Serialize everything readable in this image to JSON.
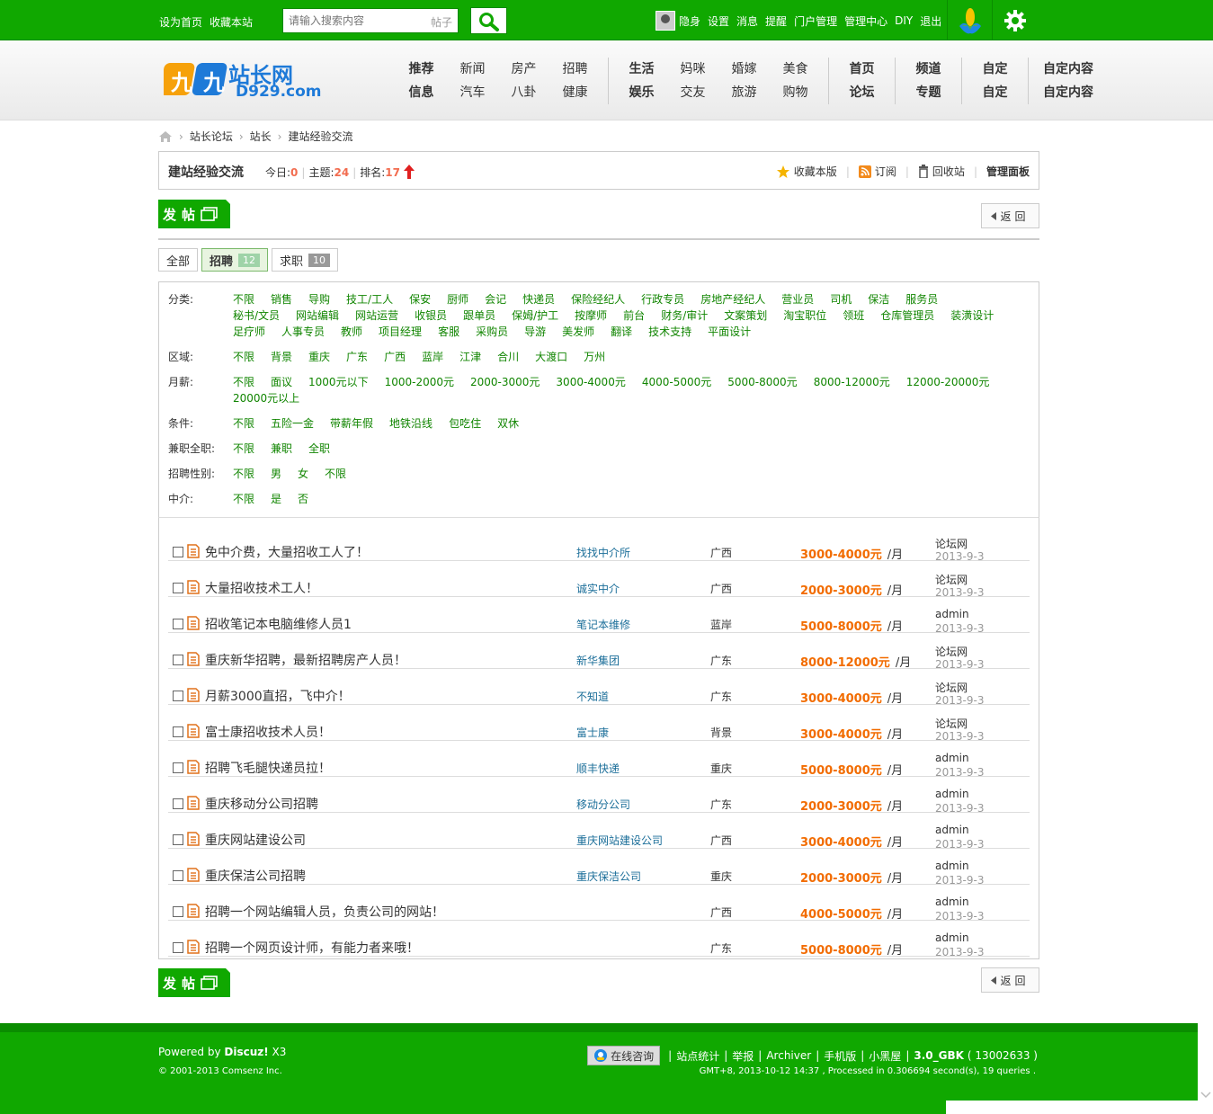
{
  "topbar": {
    "set_home": "设为首页",
    "bookmark": "收藏本站",
    "search_placeholder": "请输入搜索内容",
    "search_scope": "帖子",
    "user_links": [
      "隐身",
      "设置",
      "消息",
      "提醒",
      "门户管理",
      "管理中心",
      "DIY",
      "退出"
    ]
  },
  "logo": {
    "text_cn": "站长网",
    "text_en": "D929.com"
  },
  "nav": {
    "groups": [
      {
        "cols": [
          [
            "推荐",
            "信息"
          ],
          [
            "新闻",
            "汽车"
          ],
          [
            "房产",
            "八卦"
          ],
          [
            "招聘",
            "健康"
          ]
        ],
        "bold_first": true
      },
      {
        "cols": [
          [
            "生活",
            "娱乐"
          ],
          [
            "妈咪",
            "交友"
          ],
          [
            "婚嫁",
            "旅游"
          ],
          [
            "美食",
            "购物"
          ]
        ],
        "bold_first": true
      },
      {
        "cols": [
          [
            "首页",
            "论坛"
          ]
        ],
        "bold_first": true
      },
      {
        "cols": [
          [
            "频道",
            "专题"
          ]
        ],
        "bold_first": true
      },
      {
        "cols": [
          [
            "自定",
            "自定"
          ]
        ],
        "bold_first": true
      },
      {
        "cols": [
          [
            "自定内容",
            "自定内容"
          ]
        ],
        "bold_first": true
      }
    ]
  },
  "breadcrumb": [
    "站长论坛",
    "站长",
    "建站经验交流"
  ],
  "forum": {
    "name": "建站经验交流",
    "today_label": "今日:",
    "today": "0",
    "threads_label": "主题:",
    "threads": "24",
    "rank_label": "排名:",
    "rank": "17",
    "actions": [
      "收藏本版",
      "订阅",
      "回收站",
      "管理面板"
    ]
  },
  "post_button": "发帖",
  "back_button": "返回",
  "tabs": [
    {
      "label": "全部",
      "count": ""
    },
    {
      "label": "招聘",
      "count": "12"
    },
    {
      "label": "求职",
      "count": "10"
    }
  ],
  "filters": [
    {
      "label": "分类:",
      "options": [
        "不限",
        "销售",
        "导购",
        "技工/工人",
        "保安",
        "厨师",
        "会记",
        "快递员",
        "保险经纪人",
        "行政专员",
        "房地产经纪人",
        "营业员",
        "司机",
        "保洁",
        "服务员",
        "秘书/文员",
        "网站编辑",
        "网站运营",
        "收银员",
        "跟单员",
        "保姆/护工",
        "按摩师",
        "前台",
        "财务/审计",
        "文案策划",
        "淘宝职位",
        "领班",
        "仓库管理员",
        "装潢设计",
        "足疗师",
        "人事专员",
        "教师",
        "项目经理",
        "客服",
        "采购员",
        "导游",
        "美发师",
        "翻译",
        "技术支持",
        "平面设计"
      ]
    },
    {
      "label": "区域:",
      "options": [
        "不限",
        "背景",
        "重庆",
        "广东",
        "广西",
        "蓝岸",
        "江津",
        "合川",
        "大渡口",
        "万州"
      ]
    },
    {
      "label": "月薪:",
      "options": [
        "不限",
        "面议",
        "1000元以下",
        "1000-2000元",
        "2000-3000元",
        "3000-4000元",
        "4000-5000元",
        "5000-8000元",
        "8000-12000元",
        "12000-20000元",
        "20000元以上"
      ]
    },
    {
      "label": "条件:",
      "options": [
        "不限",
        "五险一金",
        "带薪年假",
        "地铁沿线",
        "包吃住",
        "双休"
      ]
    },
    {
      "label": "兼职全职:",
      "options": [
        "不限",
        "兼职",
        "全职"
      ]
    },
    {
      "label": "招聘性别:",
      "options": [
        "不限",
        "男",
        "女",
        "不限"
      ]
    },
    {
      "label": "中介:",
      "options": [
        "不限",
        "是",
        "否"
      ]
    }
  ],
  "threads": [
    {
      "title": "免中介费，大量招收工人了！",
      "company": "找找中介所",
      "region": "广西",
      "salary": "3000-4000元",
      "unit": "/月",
      "author": "论坛网",
      "date": "2013-9-3"
    },
    {
      "title": "大量招收技术工人！",
      "company": "诚实中介",
      "region": "广西",
      "salary": "2000-3000元",
      "unit": "/月",
      "author": "论坛网",
      "date": "2013-9-3"
    },
    {
      "title": "招收笔记本电脑维修人员1",
      "company": "笔记本维修",
      "region": "蓝岸",
      "salary": "5000-8000元",
      "unit": "/月",
      "author": "admin",
      "date": "2013-9-3"
    },
    {
      "title": "重庆新华招聘，最新招聘房产人员！",
      "company": "新华集团",
      "region": "广东",
      "salary": "8000-12000元",
      "unit": "/月",
      "author": "论坛网",
      "date": "2013-9-3"
    },
    {
      "title": "月薪3000直招，飞中介！",
      "company": "不知道",
      "region": "广东",
      "salary": "3000-4000元",
      "unit": "/月",
      "author": "论坛网",
      "date": "2013-9-3"
    },
    {
      "title": "富士康招收技术人员！",
      "company": "富士康",
      "region": "背景",
      "salary": "3000-4000元",
      "unit": "/月",
      "author": "论坛网",
      "date": "2013-9-3"
    },
    {
      "title": "招聘飞毛腿快递员拉！",
      "company": "顺丰快递",
      "region": "重庆",
      "salary": "5000-8000元",
      "unit": "/月",
      "author": "admin",
      "date": "2013-9-3"
    },
    {
      "title": "重庆移动分公司招聘",
      "company": "移动分公司",
      "region": "广东",
      "salary": "2000-3000元",
      "unit": "/月",
      "author": "admin",
      "date": "2013-9-3"
    },
    {
      "title": "重庆网站建设公司",
      "company": "重庆网站建设公司",
      "region": "广西",
      "salary": "3000-4000元",
      "unit": "/月",
      "author": "admin",
      "date": "2013-9-3"
    },
    {
      "title": "重庆保洁公司招聘",
      "company": "重庆保洁公司",
      "region": "重庆",
      "salary": "2000-3000元",
      "unit": "/月",
      "author": "admin",
      "date": "2013-9-3"
    },
    {
      "title": "招聘一个网站编辑人员，负责公司的网站！",
      "company": "",
      "region": "广西",
      "salary": "4000-5000元",
      "unit": "/月",
      "author": "admin",
      "date": "2013-9-3"
    },
    {
      "title": "招聘一个网页设计师，有能力者来哦！",
      "company": "",
      "region": "广东",
      "salary": "5000-8000元",
      "unit": "/月",
      "author": "admin",
      "date": "2013-9-3"
    }
  ],
  "footer": {
    "powered_prefix": "Powered by ",
    "powered_brand": "Discuz!",
    "powered_ver": " X3",
    "copyright": "© 2001-2013 Comsenz Inc.",
    "qq_label": "在线咨询",
    "links": [
      "站点统计",
      "举报",
      "Archiver",
      "手机版",
      "小黑屋"
    ],
    "version": "3.0_GBK",
    "version_id": "( 13002633 )",
    "gmt": "GMT+8, 2013-10-12 14:37 , Processed in 0.306694 second(s), 19 queries ."
  },
  "colors": {
    "brand_green": "#10a800",
    "salary_orange": "#f26c00",
    "filter_link": "#108500",
    "company_link": "#1b6e99"
  }
}
